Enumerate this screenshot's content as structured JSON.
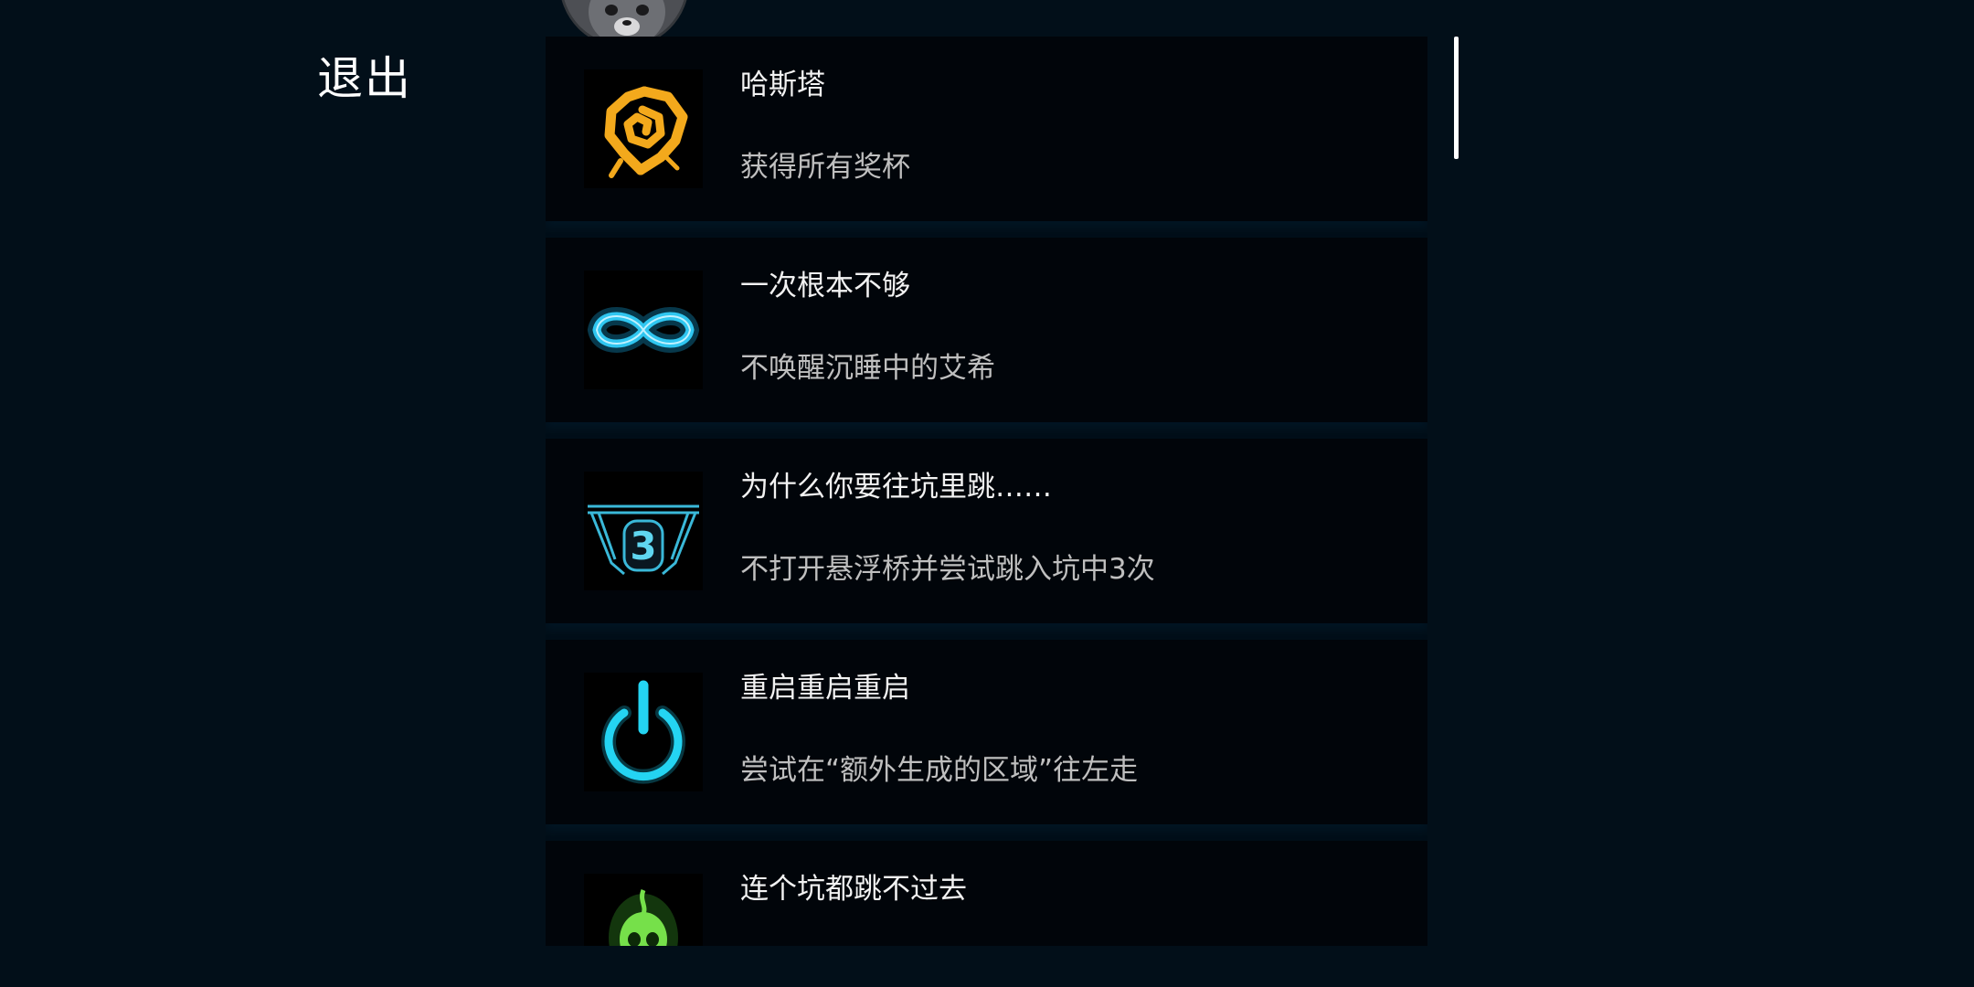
{
  "nav": {
    "exit_label": "退出"
  },
  "achievements": [
    {
      "title": "哈斯塔",
      "description": "获得所有奖杯",
      "icon": "hastur-sigil-icon",
      "color": "#f3a91c"
    },
    {
      "title": "一次根本不够",
      "description": "不唤醒沉睡中的艾希",
      "icon": "infinity-icon",
      "color": "#2fc6f0"
    },
    {
      "title": "为什么你要往坑里跳……",
      "description": "不打开悬浮桥并尝试跳入坑中3次",
      "icon": "bridge-pit-icon",
      "icon_text": "3",
      "color": "#3ab8d8"
    },
    {
      "title": "重启重启重启",
      "description": "尝试在“额外生成的区域”往左走",
      "icon": "power-icon",
      "color": "#24d4f2"
    },
    {
      "title": "连个坑都跳不过去",
      "description": "",
      "icon": "green-skull-icon",
      "color": "#76e04a"
    }
  ]
}
